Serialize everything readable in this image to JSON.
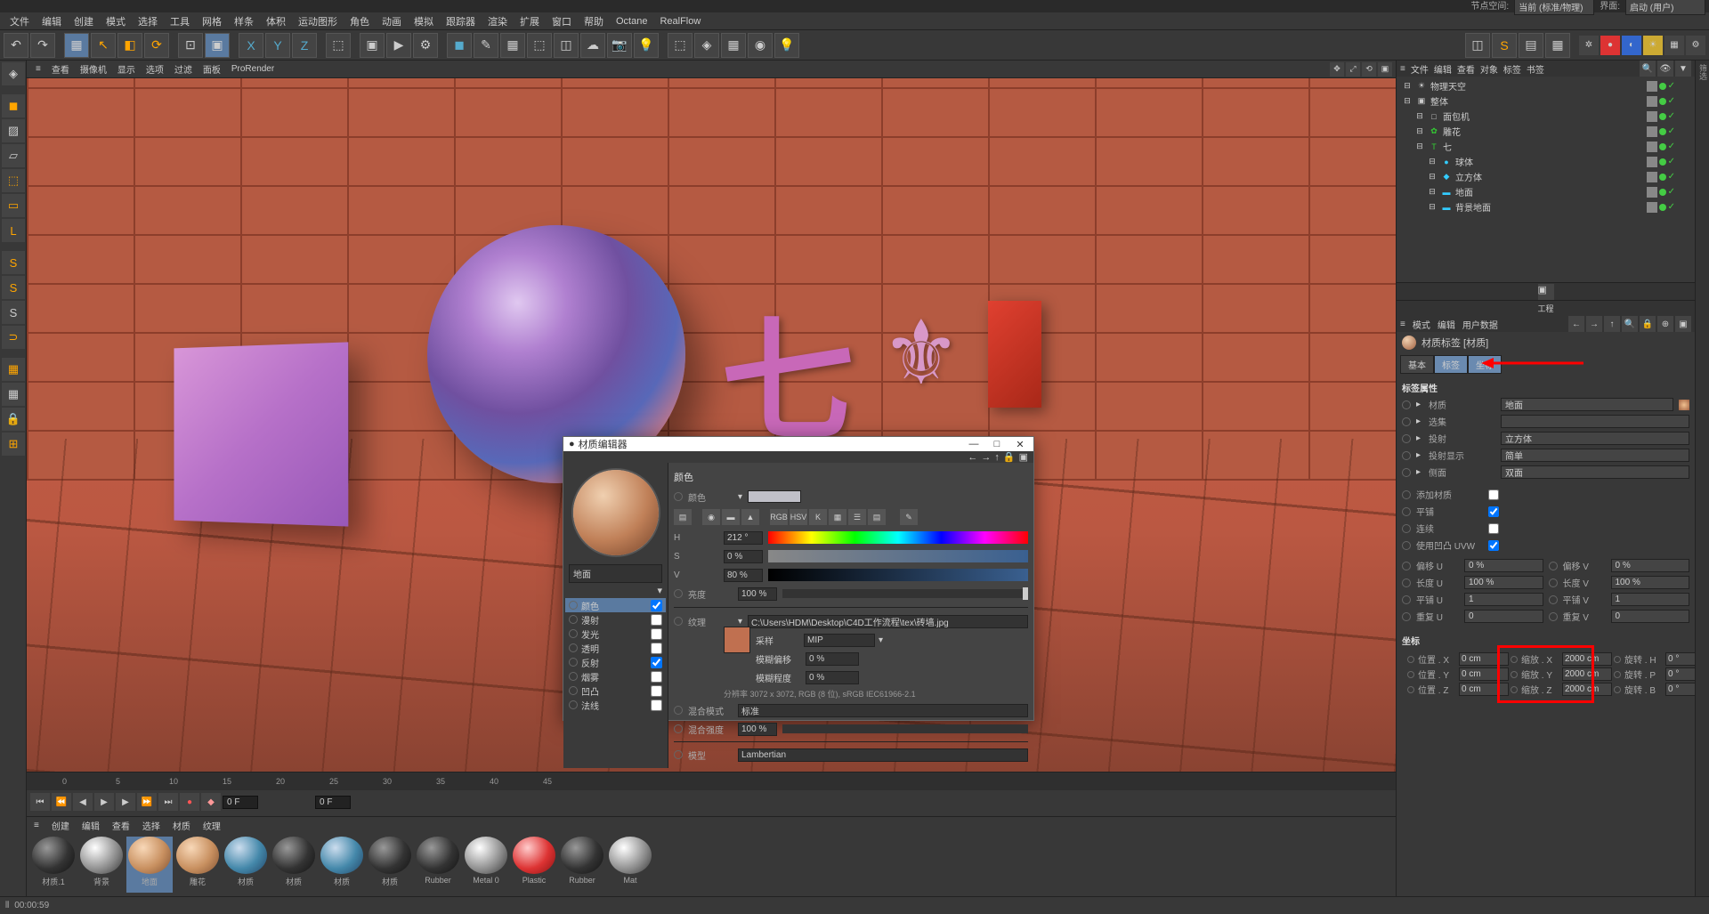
{
  "menubar": [
    "文件",
    "编辑",
    "创建",
    "模式",
    "选择",
    "工具",
    "网格",
    "样条",
    "体积",
    "运动图形",
    "角色",
    "动画",
    "模拟",
    "跟踪器",
    "渲染",
    "扩展",
    "窗口",
    "帮助",
    "Octane",
    "RealFlow"
  ],
  "menubar_right": {
    "node_space": "节点空间:",
    "node_val": "当前 (标准/物理)",
    "interface": "界面:",
    "interface_val": "启动 (用户)"
  },
  "view_menu": [
    "查看",
    "摄像机",
    "显示",
    "选项",
    "过滤",
    "面板",
    "ProRender"
  ],
  "timeline": {
    "ticks": [
      "0",
      "5",
      "10",
      "15",
      "20",
      "25",
      "30",
      "35",
      "40",
      "45"
    ],
    "frame_start": "0 F",
    "frame_cur": "0 F"
  },
  "mat_menu": [
    "创建",
    "编辑",
    "查看",
    "选择",
    "材质",
    "纹理"
  ],
  "materials": [
    {
      "name": "材质.1",
      "cls": "dark"
    },
    {
      "name": "背景",
      "cls": ""
    },
    {
      "name": "地面",
      "cls": "brown",
      "sel": true
    },
    {
      "name": "雕花",
      "cls": "brown"
    },
    {
      "name": "材质",
      "cls": "blue"
    },
    {
      "name": "材质",
      "cls": "dark"
    },
    {
      "name": "材质",
      "cls": "blue"
    },
    {
      "name": "材质",
      "cls": "dark"
    },
    {
      "name": "Rubber",
      "cls": "dark"
    },
    {
      "name": "Metal 0",
      "cls": ""
    },
    {
      "name": "Plastic",
      "cls": "red"
    },
    {
      "name": "Rubber",
      "cls": "dark"
    },
    {
      "name": "Mat",
      "cls": ""
    }
  ],
  "obj_menu": [
    "文件",
    "编辑",
    "查看",
    "对象",
    "标签",
    "书签"
  ],
  "obj_tree": [
    {
      "indent": 0,
      "icon": "☀",
      "name": "物理天空",
      "col": ""
    },
    {
      "indent": 0,
      "icon": "▣",
      "name": "整体",
      "col": ""
    },
    {
      "indent": 1,
      "icon": "□",
      "name": "面包机",
      "col": ""
    },
    {
      "indent": 1,
      "icon": "✿",
      "name": "雕花",
      "col": "#3c3"
    },
    {
      "indent": 1,
      "icon": "T",
      "name": "七",
      "col": "#3c3"
    },
    {
      "indent": 2,
      "icon": "●",
      "name": "球体",
      "col": "#3cf"
    },
    {
      "indent": 2,
      "icon": "◆",
      "name": "立方体",
      "col": "#3cf"
    },
    {
      "indent": 2,
      "icon": "▬",
      "name": "地面",
      "col": "#3cf"
    },
    {
      "indent": 2,
      "icon": "▬",
      "name": "背景地面",
      "col": "#3cf"
    }
  ],
  "attr_menu": [
    "模式",
    "编辑",
    "用户数据"
  ],
  "attr_title": "材质标签 [材质]",
  "attr_tabs": [
    "基本",
    "标签",
    "坐标"
  ],
  "tag_props": {
    "title": "标签属性",
    "rows": [
      {
        "label": "材质",
        "value": "地面",
        "type": "field",
        "extra": "sq"
      },
      {
        "label": "选集",
        "value": "",
        "type": "field"
      },
      {
        "label": "投射",
        "value": "立方体",
        "type": "select"
      },
      {
        "label": "投射显示",
        "value": "简单",
        "type": "select"
      },
      {
        "label": "侧面",
        "value": "双面",
        "type": "select"
      }
    ],
    "checks": [
      {
        "label": "添加材质",
        "checked": false
      },
      {
        "label": "平铺",
        "checked": true
      },
      {
        "label": "连续",
        "checked": false
      },
      {
        "label": "使用凹凸 UVW",
        "checked": true
      }
    ],
    "uv": [
      {
        "l1": "偏移 U",
        "v1": "0 %",
        "l2": "偏移 V",
        "v2": "0 %"
      },
      {
        "l1": "长度 U",
        "v1": "100 %",
        "l2": "长度 V",
        "v2": "100 %"
      },
      {
        "l1": "平铺 U",
        "v1": "1",
        "l2": "平铺 V",
        "v2": "1"
      },
      {
        "l1": "重复 U",
        "v1": "0",
        "l2": "重复 V",
        "v2": "0"
      }
    ]
  },
  "coords": {
    "title": "坐标",
    "rows": [
      {
        "a": "位置 . X",
        "av": "0 cm",
        "b": "缩放 . X",
        "bv": "2000 cm",
        "c": "旋转 . H",
        "cv": "0 °"
      },
      {
        "a": "位置 . Y",
        "av": "0 cm",
        "b": "缩放 . Y",
        "bv": "2000 cm",
        "c": "旋转 . P",
        "cv": "0 °"
      },
      {
        "a": "位置 . Z",
        "av": "0 cm",
        "b": "缩放 . Z",
        "bv": "2000 cm",
        "c": "旋转 . B",
        "cv": "0 °"
      }
    ]
  },
  "mat_editor": {
    "title": "材质编辑器",
    "name": "地面",
    "channels": [
      {
        "name": "颜色",
        "on": true,
        "active": true
      },
      {
        "name": "漫射",
        "on": false
      },
      {
        "name": "发光",
        "on": false
      },
      {
        "name": "透明",
        "on": false
      },
      {
        "name": "反射",
        "on": true
      },
      {
        "name": "烟雾",
        "on": false
      },
      {
        "name": "凹凸",
        "on": false
      },
      {
        "name": "法线",
        "on": false
      }
    ],
    "color_section": "颜色",
    "color_label": "颜色",
    "hsv": [
      {
        "l": "H",
        "v": "212 °"
      },
      {
        "l": "S",
        "v": "0 %"
      },
      {
        "l": "V",
        "v": "80 %"
      }
    ],
    "brightness": {
      "label": "亮度",
      "value": "100 %"
    },
    "texture": {
      "label": "纹理",
      "path": "C:\\Users\\HDM\\Desktop\\C4D工作流程\\tex\\砖墙.jpg",
      "sample": "采样",
      "sample_val": "MIP",
      "blur_offset": "模糊偏移",
      "blur_offset_v": "0 %",
      "blur_scale": "模糊程度",
      "blur_scale_v": "0 %",
      "info": "分辨率 3072 x 3072, RGB (8 位), sRGB IEC61966-2.1"
    },
    "mix": {
      "mode": "混合模式",
      "mode_v": "标准",
      "strength": "混合强度",
      "strength_v": "100 %"
    },
    "model": {
      "label": "模型",
      "value": "Lambertian"
    }
  },
  "status": {
    "time": "00:00:59"
  },
  "side_label": "筛选",
  "proj_label": "工程"
}
